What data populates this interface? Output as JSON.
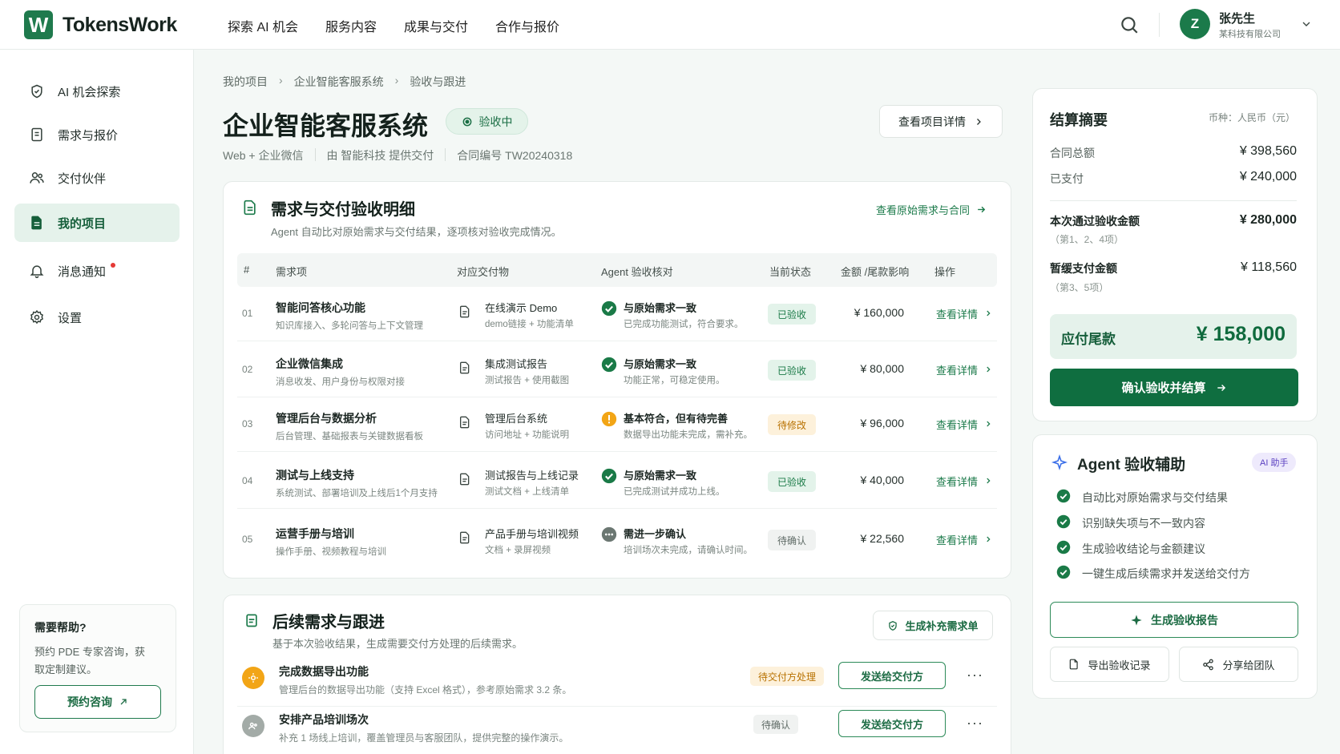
{
  "brand": {
    "logo_letter": "W",
    "name": "TokensWork"
  },
  "topnav": [
    "探索 AI 机会",
    "服务内容",
    "成果与交付",
    "合作与报价"
  ],
  "user": {
    "initial": "Z",
    "name": "张先生",
    "company": "某科技有限公司"
  },
  "sidebar": {
    "items": [
      {
        "label": "AI 机会探索",
        "icon": "shield-icon"
      },
      {
        "label": "需求与报价",
        "icon": "document-icon"
      },
      {
        "label": "交付伙伴",
        "icon": "users-icon"
      },
      {
        "label": "我的项目",
        "icon": "project-icon",
        "active": true
      },
      {
        "label": "消息通知",
        "icon": "bell-icon",
        "dot": true
      },
      {
        "label": "设置",
        "icon": "gear-icon"
      }
    ],
    "help": {
      "title": "需要帮助?",
      "text": "预约 PDE 专家咨询，获取定制建议。",
      "button": "预约咨询"
    }
  },
  "breadcrumb": [
    "我的项目",
    "企业智能客服系统",
    "验收与跟进"
  ],
  "project": {
    "title": "企业智能客服系统",
    "status": "验收中",
    "meta": [
      "Web + 企业微信",
      "由 智能科技 提供交付",
      "合同编号 TW20240318"
    ],
    "detail_button": "查看项目详情"
  },
  "acceptance": {
    "title": "需求与交付验收明细",
    "subtitle": "Agent 自动比对原始需求与交付结果，逐项核对验收完成情况。",
    "link": "查看原始需求与合同",
    "columns": [
      "#",
      "需求项",
      "对应交付物",
      "Agent 验收核对",
      "当前状态",
      "金额 /尾款影响",
      "操作"
    ],
    "rows": [
      {
        "no": "01",
        "title": "智能问答核心功能",
        "sub": "知识库接入、多轮问答与上下文管理",
        "deliverable": "在线演示 Demo",
        "deliverable_sub": "demo链接 + 功能清单",
        "check": "与原始需求一致",
        "check_sub": "已完成功能测试，符合要求。",
        "check_type": "ok",
        "status": "已验收",
        "status_type": "ok",
        "amount": "¥ 160,000",
        "op": "查看详情"
      },
      {
        "no": "02",
        "title": "企业微信集成",
        "sub": "消息收发、用户身份与权限对接",
        "deliverable": "集成测试报告",
        "deliverable_sub": "测试报告 + 使用截图",
        "check": "与原始需求一致",
        "check_sub": "功能正常，可稳定使用。",
        "check_type": "ok",
        "status": "已验收",
        "status_type": "ok",
        "amount": "¥ 80,000",
        "op": "查看详情"
      },
      {
        "no": "03",
        "title": "管理后台与数据分析",
        "sub": "后台管理、基础报表与关键数据看板",
        "deliverable": "管理后台系统",
        "deliverable_sub": "访问地址 + 功能说明",
        "check": "基本符合，但有待完善",
        "check_sub": "数据导出功能未完成，需补充。",
        "check_type": "warn",
        "status": "待修改",
        "status_type": "fix",
        "amount": "¥ 96,000",
        "op": "查看详情"
      },
      {
        "no": "04",
        "title": "测试与上线支持",
        "sub": "系统测试、部署培训及上线后1个月支持",
        "deliverable": "测试报告与上线记录",
        "deliverable_sub": "测试文档 + 上线清单",
        "check": "与原始需求一致",
        "check_sub": "已完成测试并成功上线。",
        "check_type": "ok",
        "status": "已验收",
        "status_type": "ok",
        "amount": "¥ 40,000",
        "op": "查看详情"
      },
      {
        "no": "05",
        "title": "运营手册与培训",
        "sub": "操作手册、视频教程与培训",
        "deliverable": "产品手册与培训视频",
        "deliverable_sub": "文档 + 录屏视频",
        "check": "需进一步确认",
        "check_sub": "培训场次未完成，请确认时间。",
        "check_type": "pending",
        "status": "待确认",
        "status_type": "wait",
        "amount": "¥ 22,560",
        "op": "查看详情"
      }
    ]
  },
  "followup": {
    "title": "后续需求与跟进",
    "subtitle": "基于本次验收结果，生成需要交付方处理的后续需求。",
    "gen_button": "生成补充需求单",
    "items": [
      {
        "title": "完成数据导出功能",
        "sub": "管理后台的数据导出功能（支持 Excel 格式），参考原始需求 3.2 条。",
        "badge": "待交付方处理",
        "badge_type": "fix",
        "button": "发送给交付方",
        "more": "···"
      },
      {
        "title": "安排产品培训场次",
        "sub": "补充 1 场线上培训，覆盖管理员与客服团队，提供完整的操作演示。",
        "badge": "待确认",
        "badge_type": "wait",
        "button": "发送给交付方",
        "more": "···"
      }
    ]
  },
  "summary": {
    "title": "结算摘要",
    "currency": "币种：人民币（元）",
    "contract_label": "合同总额",
    "contract_value": "¥ 398,560",
    "paid_label": "已支付",
    "paid_value": "¥ 240,000",
    "passed_label": "本次通过验收金额",
    "passed_note": "（第1、2、4项）",
    "passed_value": "¥ 280,000",
    "hold_label": "暂缓支付金额",
    "hold_note": "（第3、5项）",
    "hold_value": "¥ 118,560",
    "due_label": "应付尾款",
    "due_value": "¥ 158,000",
    "confirm_button": "确认验收并结算"
  },
  "agent": {
    "title": "Agent 验收辅助",
    "chip": "AI 助手",
    "items": [
      "自动比对原始需求与交付结果",
      "识别缺失项与不一致内容",
      "生成验收结论与金额建议",
      "一键生成后续需求并发送给交付方"
    ],
    "report_button": "生成验收报告",
    "export_button": "导出验收记录",
    "share_button": "分享给团队"
  },
  "colors": {
    "primary": "#0f6e40",
    "accent_bg": "#e5f2eb",
    "warn": "#f2a516",
    "danger": "#e53935"
  }
}
